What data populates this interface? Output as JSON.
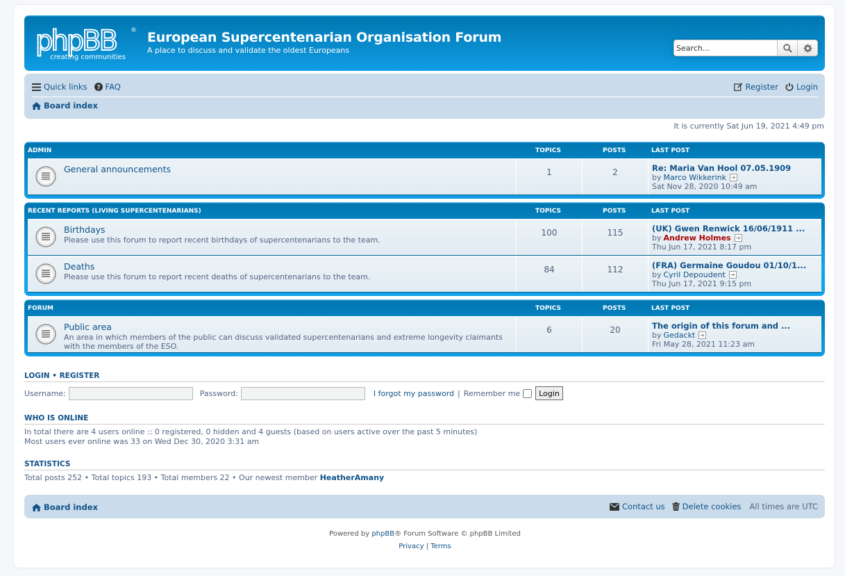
{
  "header": {
    "logo_main": "phpBB",
    "logo_tag": "creating communities",
    "title": "European Supercentenarian Organisation Forum",
    "description": "A place to discuss and validate the oldest Europeans",
    "search_placeholder": "Search…"
  },
  "navbar": {
    "quick_links": "Quick links",
    "faq": "FAQ",
    "register": "Register",
    "login": "Login",
    "board_index": "Board index"
  },
  "current_time": "It is currently Sat Jun 19, 2021 4:49 pm",
  "columns": {
    "topics": "TOPICS",
    "posts": "POSTS",
    "last_post": "LAST POST"
  },
  "categories": [
    {
      "name": "ADMIN",
      "forums": [
        {
          "name": "General announcements",
          "description": "",
          "topics": "1",
          "posts": "2",
          "last_title": "Re: Maria Van Hool 07.05.1909",
          "by": "by",
          "last_author": "Marco Wikkerink",
          "last_date": "Sat Nov 28, 2020 10:49 am"
        }
      ]
    },
    {
      "name": "RECENT REPORTS (LIVING SUPERCENTENARIANS)",
      "forums": [
        {
          "name": "Birthdays",
          "description": "Please use this forum to report recent birthdays of supercentenarians to the team.",
          "topics": "100",
          "posts": "115",
          "last_title": "(UK) Gwen Renwick 16/06/1911 ...",
          "by": "by",
          "last_author": "Andrew Holmes",
          "last_date": "Thu Jun 17, 2021 8:17 pm"
        },
        {
          "name": "Deaths",
          "description": "Please use this forum to report recent deaths of supercentenarians to the team.",
          "topics": "84",
          "posts": "112",
          "last_title": "(FRA) Germaine Goudou 01/10/1...",
          "by": "by",
          "last_author": "Cyril Depoudent",
          "last_date": "Thu Jun 17, 2021 9:15 pm"
        }
      ]
    },
    {
      "name": "FORUM",
      "forums": [
        {
          "name": "Public area",
          "description": "An area in which members of the public can discuss validated supercentenarians and extreme longevity claimants with the members of the ESO.",
          "topics": "6",
          "posts": "20",
          "last_title": "The origin of this forum and ...",
          "by": "by",
          "last_author": "Gedackt",
          "last_date": "Fri May 28, 2021 11:23 am"
        }
      ]
    }
  ],
  "login": {
    "heading_login": "LOGIN",
    "heading_sep": "•",
    "heading_register": "REGISTER",
    "username_label": "Username:",
    "password_label": "Password:",
    "forgot": "I forgot my password",
    "pipe": "|",
    "remember": "Remember me",
    "button": "Login"
  },
  "online": {
    "heading": "WHO IS ONLINE",
    "line1": "In total there are 4 users online :: 0 registered, 0 hidden and 4 guests (based on users active over the past 5 minutes)",
    "line2": "Most users ever online was 33 on Wed Dec 30, 2020 3:31 am"
  },
  "statistics": {
    "heading": "STATISTICS",
    "text": "Total posts 252 • Total topics 193 • Total members 22 • Our newest member",
    "newest": "HeatherAmany"
  },
  "footer": {
    "board_index": "Board index",
    "contact": "Contact us",
    "delete_cookies": "Delete cookies",
    "timezone": "All times are UTC",
    "powered_prefix": "Powered by",
    "phpbb": "phpBB",
    "powered_suffix": "® Forum Software © phpBB Limited",
    "privacy": "Privacy",
    "sep": "|",
    "terms": "Terms"
  }
}
